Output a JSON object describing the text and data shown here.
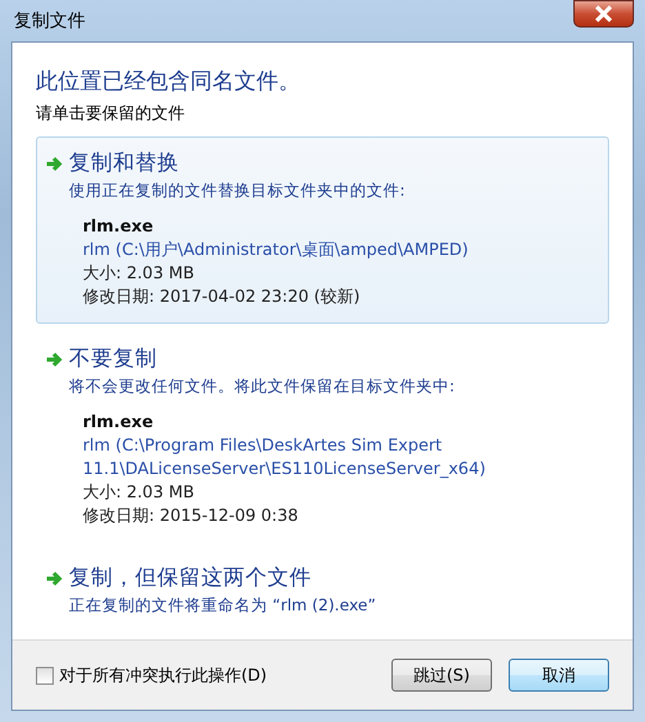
{
  "window": {
    "title": "复制文件"
  },
  "heading": "此位置已经包含同名文件。",
  "instruction": "请单击要保留的文件",
  "options": [
    {
      "title": "复制和替换",
      "description": "使用正在复制的文件替换目标文件夹中的文件:",
      "selected": true,
      "file": {
        "name": "rlm.exe",
        "location": "rlm (C:\\用户\\Administrator\\桌面\\amped\\AMPED)",
        "size": "大小: 2.03 MB",
        "modified": "修改日期: 2017-04-02 23:20 (较新)"
      }
    },
    {
      "title": "不要复制",
      "description": "将不会更改任何文件。将此文件保留在目标文件夹中:",
      "selected": false,
      "file": {
        "name": "rlm.exe",
        "location": "rlm (C:\\Program Files\\DeskArtes Sim Expert 11.1\\DALicenseServer\\ES110LicenseServer_x64)",
        "size": "大小: 2.03 MB",
        "modified": "修改日期: 2015-12-09 0:38"
      }
    },
    {
      "title": "复制，但保留这两个文件",
      "description": "正在复制的文件将重命名为 “rlm (2).exe”",
      "selected": false
    }
  ],
  "apply_all": {
    "label": "对于所有冲突执行此操作(D)",
    "checked": false
  },
  "buttons": [
    {
      "label": "跳过(S)",
      "default": false
    },
    {
      "label": "取消",
      "default": true
    }
  ]
}
